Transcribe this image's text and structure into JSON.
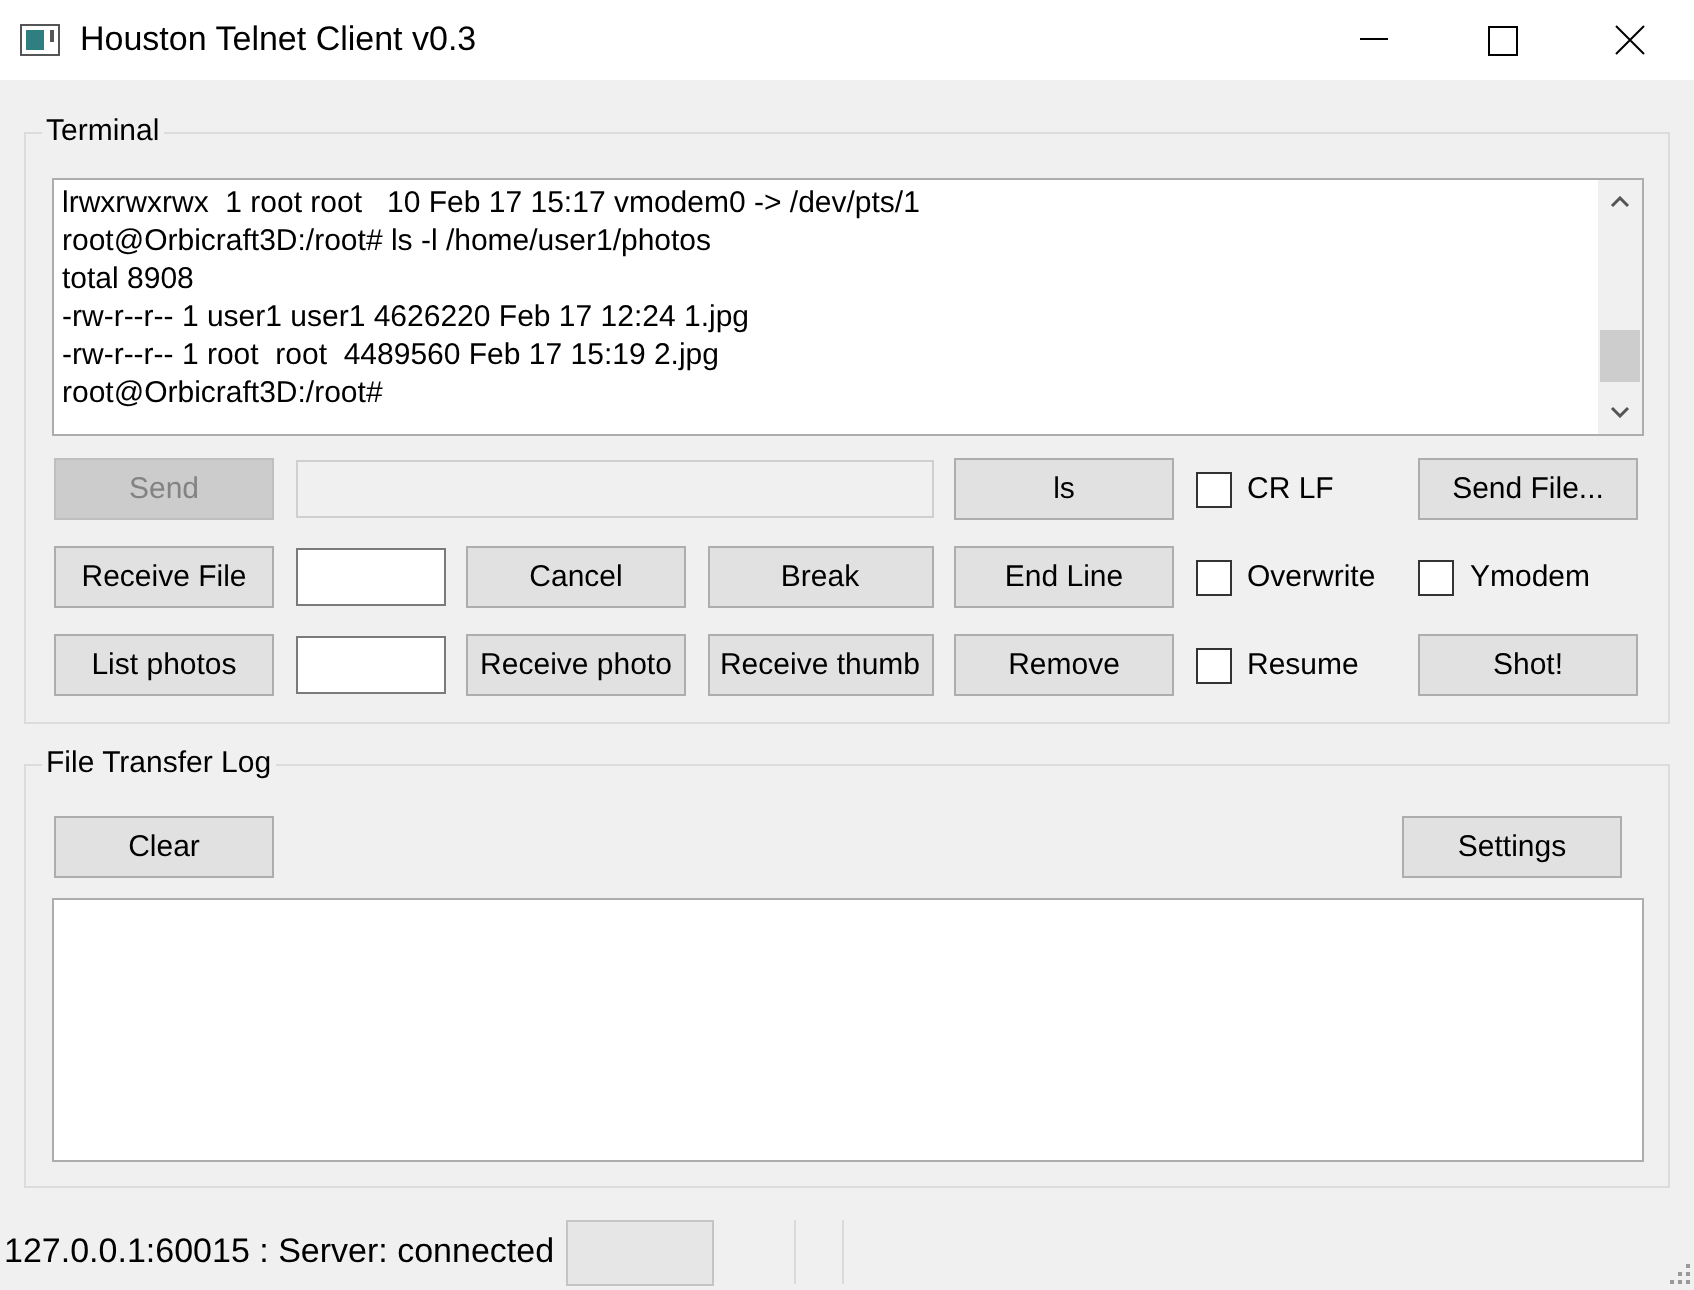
{
  "window": {
    "title": "Houston Telnet Client v0.3"
  },
  "terminal": {
    "title": "Terminal",
    "lines": [
      "lrwxrwxrwx  1 root root   10 Feb 17 15:17 vmodem0 -> /dev/pts/1",
      "root@Orbicraft3D:/root# ls -l /home/user1/photos",
      "total 8908",
      "-rw-r--r-- 1 user1 user1 4626220 Feb 17 12:24 1.jpg",
      "-rw-r--r-- 1 root  root  4489560 Feb 17 15:19 2.jpg",
      "root@Orbicraft3D:/root#"
    ],
    "controls": [
      {
        "kind": "button",
        "label": "Send",
        "disabled": true
      },
      {
        "kind": "command_field",
        "disabled": true
      },
      {
        "kind": "button",
        "label": "ls",
        "disabled": false
      },
      {
        "kind": "checkbox",
        "label": "CR LF",
        "checked": false
      },
      {
        "kind": "button",
        "label": "Send File...",
        "disabled": false
      },
      {
        "kind": "button",
        "label": "Receive File",
        "disabled": false
      },
      {
        "kind": "field",
        "disabled": false
      },
      {
        "kind": "button",
        "label": "Cancel",
        "disabled": false
      },
      {
        "kind": "button",
        "label": "Break",
        "disabled": false
      },
      {
        "kind": "button",
        "label": "End Line",
        "disabled": false
      },
      {
        "kind": "checkbox",
        "label": "Overwrite",
        "checked": false
      },
      {
        "kind": "checkbox",
        "label": "Ymodem",
        "checked": false
      },
      {
        "kind": "button",
        "label": "List photos",
        "disabled": false
      },
      {
        "kind": "field",
        "disabled": false
      },
      {
        "kind": "button",
        "label": "Receive photo",
        "disabled": false
      },
      {
        "kind": "button",
        "label": "Receive thumb",
        "disabled": false
      },
      {
        "kind": "button",
        "label": "Remove",
        "disabled": false
      },
      {
        "kind": "checkbox",
        "label": "Resume",
        "checked": false
      },
      {
        "kind": "button",
        "label": "Shot!",
        "disabled": false
      }
    ]
  },
  "log": {
    "title": "File Transfer Log",
    "buttons": [
      "Clear",
      "Settings"
    ]
  },
  "status_bar": {
    "text": "127.0.0.1:60015 : Server: connected"
  }
}
